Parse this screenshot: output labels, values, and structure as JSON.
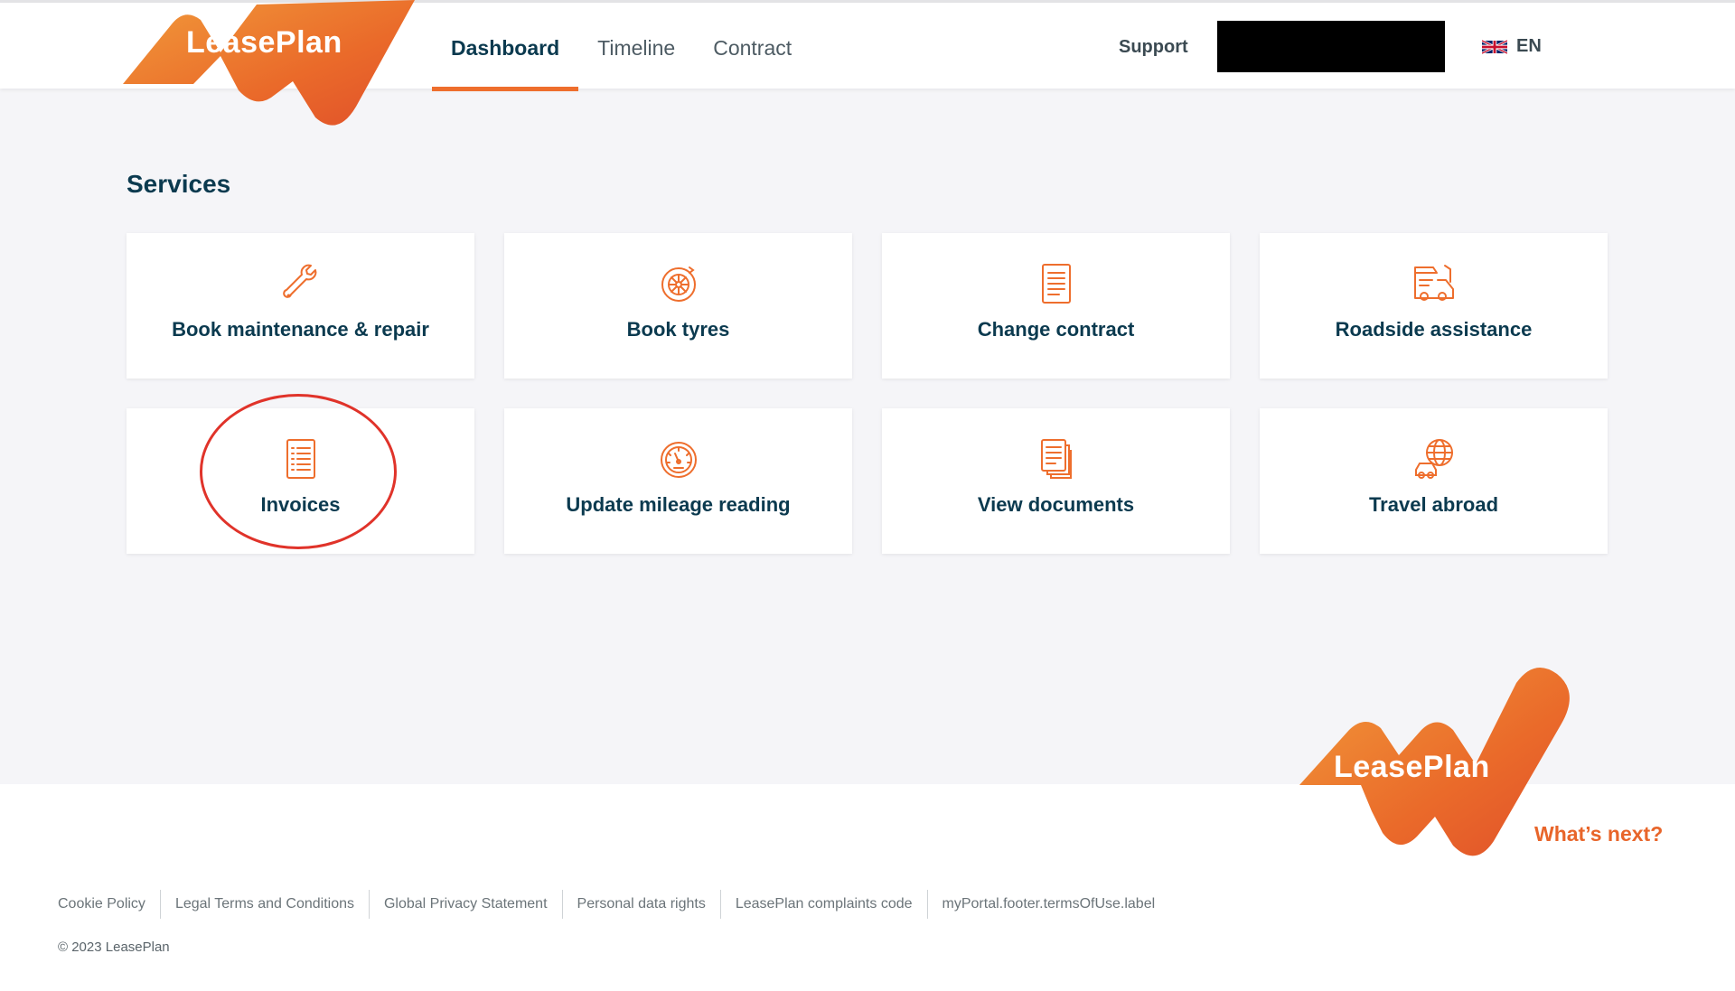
{
  "brand": {
    "name": "LeasePlan",
    "accent_color": "#ee6e2d",
    "text_color": "#0b3a4f"
  },
  "header": {
    "nav": [
      {
        "label": "Dashboard",
        "active": true
      },
      {
        "label": "Timeline",
        "active": false
      },
      {
        "label": "Contract",
        "active": false
      }
    ],
    "support_label": "Support",
    "language": {
      "label": "EN",
      "icon": "uk-flag-icon"
    }
  },
  "main": {
    "section_title": "Services",
    "services": [
      {
        "label": "Book maintenance & repair",
        "icon": "wrench-icon"
      },
      {
        "label": "Book tyres",
        "icon": "tyre-icon"
      },
      {
        "label": "Change contract",
        "icon": "document-icon"
      },
      {
        "label": "Roadside assistance",
        "icon": "tow-truck-icon"
      },
      {
        "label": "Invoices",
        "icon": "invoice-icon",
        "highlighted": true
      },
      {
        "label": "Update mileage reading",
        "icon": "speedometer-icon"
      },
      {
        "label": "View documents",
        "icon": "documents-stack-icon"
      },
      {
        "label": "Travel abroad",
        "icon": "globe-car-icon"
      }
    ]
  },
  "footer": {
    "tagline": "What’s next?",
    "links": [
      "Cookie Policy",
      "Legal Terms and Conditions",
      "Global Privacy Statement",
      "Personal data rights",
      "LeasePlan complaints code",
      "myPortal.footer.termsOfUse.label"
    ],
    "copyright": "© 2023 LeasePlan"
  }
}
